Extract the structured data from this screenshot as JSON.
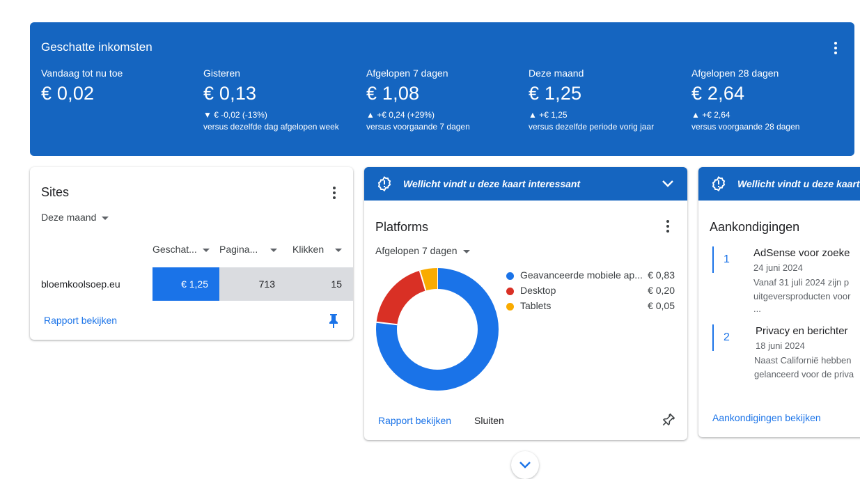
{
  "earnings": {
    "title": "Geschatte inkomsten",
    "menu_icon": "more-vert-icon",
    "metrics": [
      {
        "label": "Vandaag tot nu toe",
        "value": "€ 0,02",
        "change": "",
        "comparison": ""
      },
      {
        "label": "Gisteren",
        "value": "€ 0,13",
        "change": "▼ € -0,02 (-13%)",
        "comparison": "versus dezelfde dag afgelopen week"
      },
      {
        "label": "Afgelopen 7 dagen",
        "value": "€ 1,08",
        "change": "▲ +€ 0,24 (+29%)",
        "comparison": "versus voorgaande 7 dagen"
      },
      {
        "label": "Deze maand",
        "value": "€ 1,25",
        "change": "▲ +€ 1,25",
        "comparison": "versus dezelfde periode vorig jaar"
      },
      {
        "label": "Afgelopen 28 dagen",
        "value": "€ 2,64",
        "change": "▲ +€ 2,64",
        "comparison": "versus voorgaande 28 dagen"
      }
    ]
  },
  "sites": {
    "title": "Sites",
    "period": "Deze maand",
    "columns": [
      "Geschat...",
      "Pagina...",
      "Klikken"
    ],
    "rows": [
      {
        "site": "bloemkoolsoep.eu",
        "earnings": "€ 1,25",
        "pageviews": "713",
        "clicks": "15"
      }
    ],
    "report_link": "Rapport bekijken",
    "pin_icon": "pin-filled-icon"
  },
  "platforms": {
    "banner_text": "Wellicht vindt u deze kaart interessant",
    "title": "Platforms",
    "period": "Afgelopen 7 dagen",
    "legend": [
      {
        "name": "Geavanceerde mobiele ap...",
        "amount": "€ 0,83",
        "color": "#1a73e8"
      },
      {
        "name": "Desktop",
        "amount": "€ 0,20",
        "color": "#d93025"
      },
      {
        "name": "Tablets",
        "amount": "€ 0,05",
        "color": "#f9ab00"
      }
    ],
    "report_link": "Rapport bekijken",
    "close_label": "Sluiten",
    "pin_icon": "pin-outline-icon"
  },
  "chart_data": {
    "type": "pie",
    "categories": [
      "Geavanceerde mobiele ap...",
      "Desktop",
      "Tablets"
    ],
    "values": [
      0.83,
      0.2,
      0.05
    ],
    "colors": [
      "#1a73e8",
      "#d93025",
      "#f9ab00"
    ],
    "donut": true,
    "legend": "right"
  },
  "announcements": {
    "banner_text": "Wellicht vindt u deze kaart i",
    "title": "Aankondigingen",
    "items": [
      {
        "num": "1",
        "title": "AdSense voor zoeke",
        "date": "24 juni 2024",
        "line1": "Vanaf 31 juli 2024 zijn p",
        "line2": "uitgeversproducten voor",
        "line3": "..."
      },
      {
        "num": "2",
        "title": "Privacy en berichter",
        "date": "18 juni 2024",
        "line1": "Naast Californië hebben",
        "line2": "gelanceerd voor de priva",
        "line3": ""
      }
    ],
    "view_link": "Aankondigingen bekijken"
  },
  "scroll_icon": "chevron-down-icon"
}
